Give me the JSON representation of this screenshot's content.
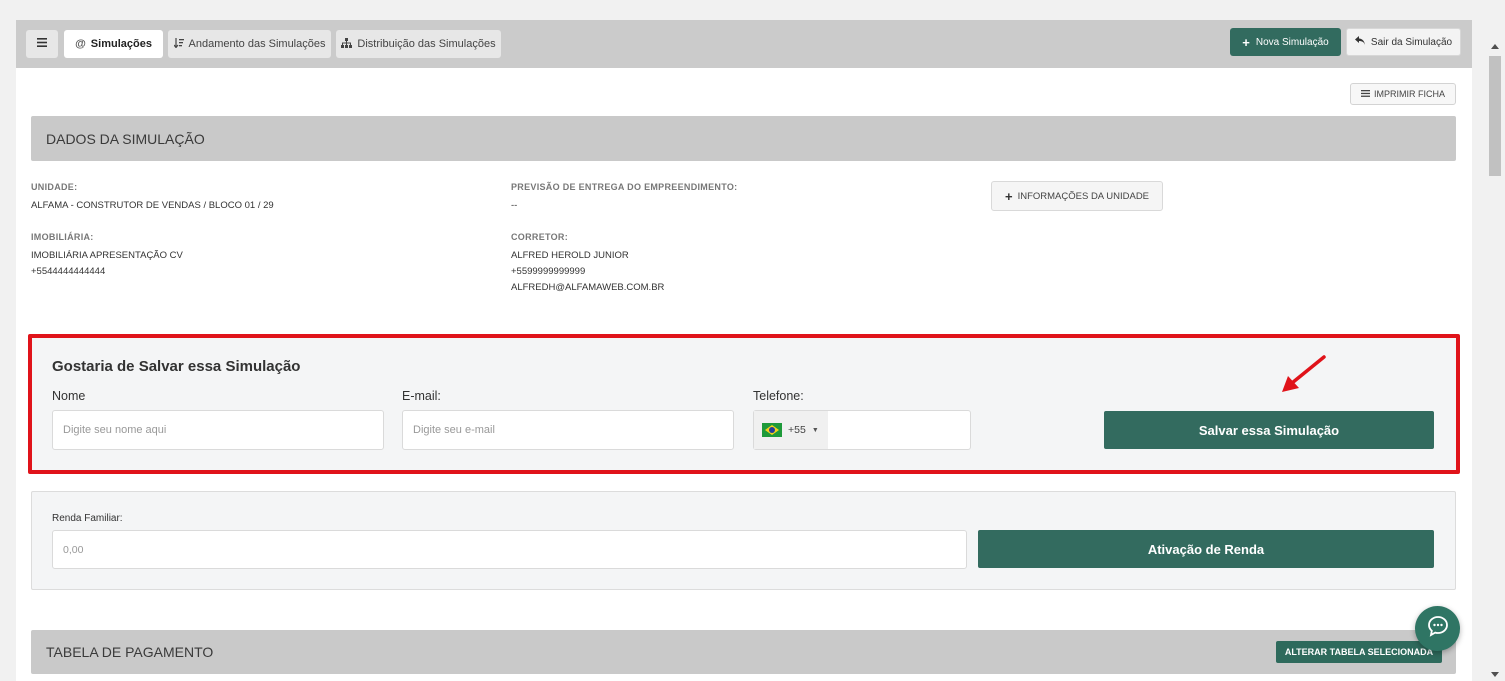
{
  "tabs": {
    "menu_icon": "hamburger-icon",
    "items": [
      {
        "label": "Simulações",
        "icon": "at-icon"
      },
      {
        "label": "Andamento das Simulações",
        "icon": "sort-icon"
      },
      {
        "label": "Distribuição das Simulações",
        "icon": "sitemap-icon"
      }
    ]
  },
  "actions": {
    "new_simulation": "Nova Simulação",
    "exit_simulation": "Sair da Simulação",
    "print": "IMPRIMIR FICHA"
  },
  "dados": {
    "title": "DADOS DA SIMULAÇÃO",
    "unidade_label": "UNIDADE:",
    "unidade_value": "ALFAMA - CONSTRUTOR DE VENDAS / BLOCO 01 / 29",
    "previsao_label": "PREVISÃO DE ENTREGA DO EMPREENDIMENTO:",
    "previsao_value": "--",
    "info_unidade_button": "INFORMAÇÕES DA UNIDADE",
    "imobiliaria_label": "IMOBILIÁRIA:",
    "imobiliaria_name": "IMOBILIÁRIA APRESENTAÇÃO CV",
    "imobiliaria_phone": "+5544444444444",
    "corretor_label": "CORRETOR:",
    "corretor_name": "ALFRED HEROLD JUNIOR",
    "corretor_phone": "+5599999999999",
    "corretor_email": "ALFREDH@ALFAMAWEB.COM.BR"
  },
  "save": {
    "title": "Gostaria de Salvar essa Simulação",
    "name_label": "Nome",
    "name_placeholder": "Digite seu nome aqui",
    "email_label": "E-mail:",
    "email_placeholder": "Digite seu e-mail",
    "phone_label": "Telefone:",
    "phone_code": "+55",
    "button": "Salvar essa Simulação"
  },
  "renda": {
    "label": "Renda Familiar:",
    "value": "0,00",
    "button": "Ativação de Renda"
  },
  "tabela": {
    "title": "TABELA DE PAGAMENTO",
    "button": "ALTERAR TABELA SELECIONADA"
  },
  "colors": {
    "primary": "#336b5f",
    "highlight": "#e0131a"
  }
}
